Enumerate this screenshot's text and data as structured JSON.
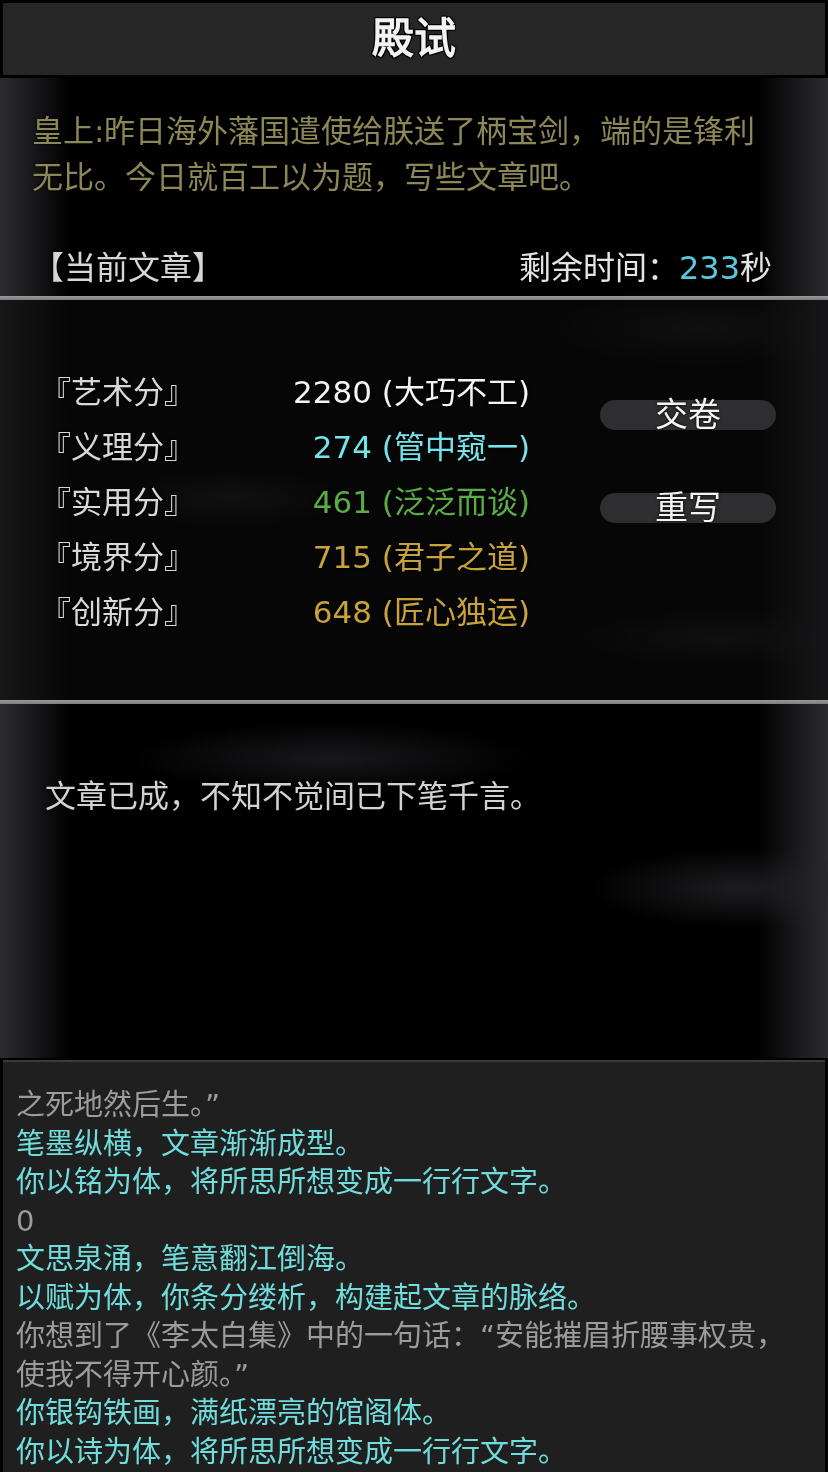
{
  "header": {
    "title": "殿试"
  },
  "prompt": {
    "text": "皇上:昨日海外藩国遣使给朕送了柄宝剑，端的是锋利无比。今日就百工以为题，写些文章吧。"
  },
  "essay_bar": {
    "label": "【当前文章】",
    "timer_label": "剩余时间：",
    "timer_value": "233",
    "timer_unit": "秒"
  },
  "scores": [
    {
      "label": "『艺术分』",
      "value": "2280 (大巧不工)",
      "color": "#f4f4f4"
    },
    {
      "label": "『义理分』",
      "value": "274 (管中窥一)",
      "color": "#74e4ea"
    },
    {
      "label": "『实用分』",
      "value": "461 (泛泛而谈)",
      "color": "#5aad45"
    },
    {
      "label": "『境界分』",
      "value": "715 (君子之道)",
      "color": "#c8a23a"
    },
    {
      "label": "『创新分』",
      "value": "648 (匠心独运)",
      "color": "#c8a23a"
    }
  ],
  "actions": [
    {
      "label": "交卷"
    },
    {
      "label": "重写"
    }
  ],
  "message": "文章已成，不知不觉间已下笔千言。",
  "log": [
    {
      "kind": "plain",
      "text": "之死地然后生。”"
    },
    {
      "kind": "highlight",
      "text": "笔墨纵横，文章渐渐成型。"
    },
    {
      "kind": "highlight",
      "text": "你以铭为体，将所思所想变成一行行文字。"
    },
    {
      "kind": "plain",
      "text": "0"
    },
    {
      "kind": "highlight",
      "text": "文思泉涌，笔意翻江倒海。"
    },
    {
      "kind": "highlight",
      "text": "以赋为体，你条分缕析，构建起文章的脉络。"
    },
    {
      "kind": "plain",
      "text": "你想到了《李太白集》中的一句话：“安能摧眉折腰事权贵，使我不得开心颜。”"
    },
    {
      "kind": "highlight",
      "text": "你银钩铁画，满纸漂亮的馆阁体。"
    },
    {
      "kind": "highlight",
      "text": "你以诗为体，将所思所想变成一行行文字。"
    }
  ]
}
